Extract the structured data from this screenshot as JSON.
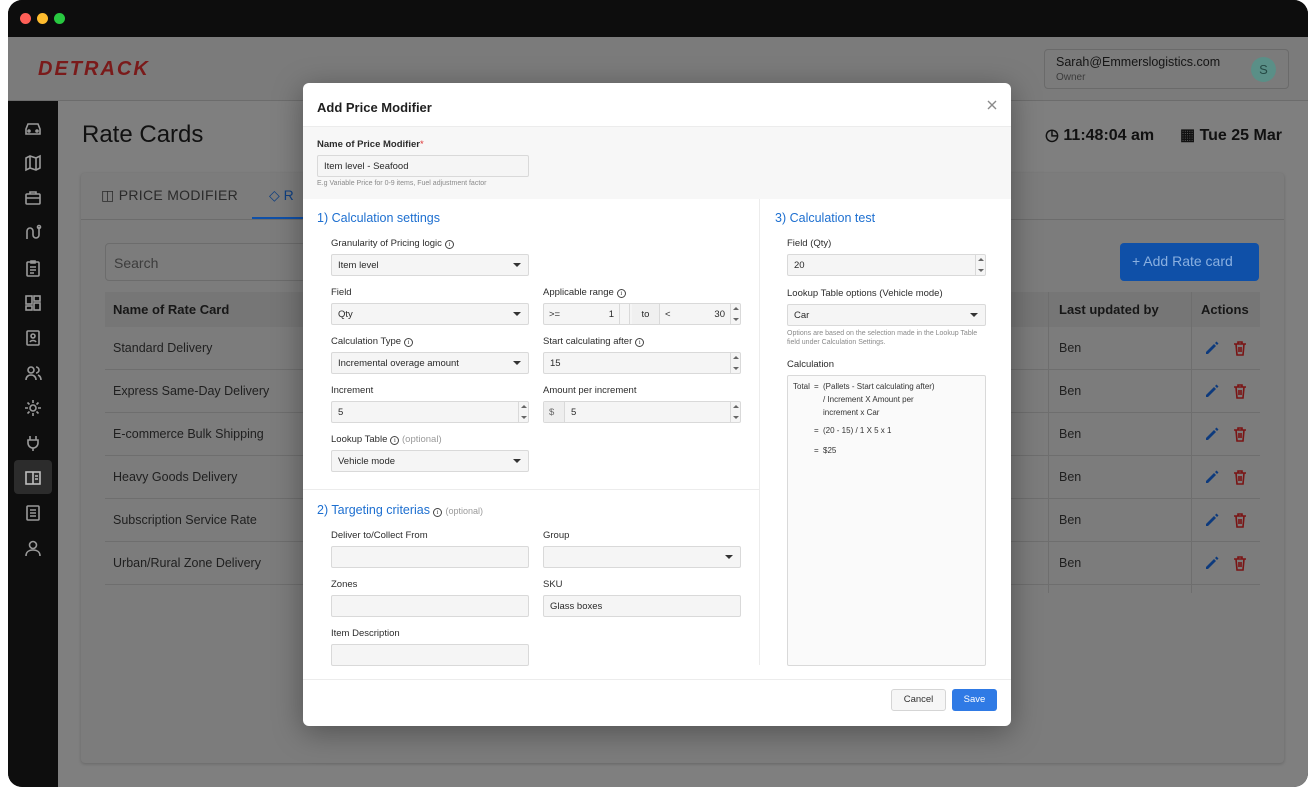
{
  "app": {
    "logo_text": "DETRACK",
    "user_email": "Sarah@Emmerslogistics.com",
    "user_role": "Owner",
    "avatar_initial": "S"
  },
  "page": {
    "title": "Rate Cards",
    "time": "11:48:04 am",
    "date": "Tue 25 Mar"
  },
  "tabs": {
    "price_modifier": "PRICE MODIFIER",
    "rate_cards_partial": "R"
  },
  "toolbar": {
    "search_placeholder": "Search",
    "add_button": "Add Rate card"
  },
  "table": {
    "headers": {
      "name": "Name of Rate Card",
      "last_updated_by": "Last updated by",
      "actions": "Actions"
    },
    "rows": [
      {
        "name": "Standard Delivery",
        "by": "Ben"
      },
      {
        "name": "Express Same-Day Delivery",
        "by": "Ben"
      },
      {
        "name": "E-commerce Bulk Shipping",
        "by": "Ben"
      },
      {
        "name": "Heavy Goods Delivery",
        "by": "Ben"
      },
      {
        "name": "Subscription Service Rate",
        "by": "Ben"
      },
      {
        "name": "Urban/Rural Zone Delivery",
        "by": "Ben"
      }
    ]
  },
  "modal": {
    "title": "Add Price Modifier",
    "name_label": "Name of Price Modifier",
    "name_value": "Item level - Seafood",
    "name_hint": "E.g Variable Price for 0-9 items, Fuel adjustment factor",
    "calc_settings": {
      "title": "1) Calculation settings",
      "granularity_label": "Granularity of Pricing logic",
      "granularity_value": "Item level",
      "field_label": "Field",
      "field_value": "Qty",
      "range_label": "Applicable range",
      "range_op1": ">=",
      "range_val1": "1",
      "range_to": "to",
      "range_op2": "<",
      "range_val2": "30",
      "calc_type_label": "Calculation Type",
      "calc_type_value": "Incremental overage amount",
      "start_after_label": "Start calculating after",
      "start_after_value": "15",
      "increment_label": "Increment",
      "increment_value": "5",
      "amount_label": "Amount per increment",
      "amount_prefix": "$",
      "amount_value": "5",
      "lookup_label": "Lookup Table",
      "lookup_optional": "(optional)",
      "lookup_value": "Vehicle mode"
    },
    "targeting": {
      "title": "2) Targeting criterias",
      "optional": "(optional)",
      "deliver_label": "Deliver to/Collect From",
      "deliver_value": "",
      "group_label": "Group",
      "group_value": "",
      "zones_label": "Zones",
      "zones_value": "",
      "sku_label": "SKU",
      "sku_value": "Glass boxes",
      "desc_label": "Item Description",
      "desc_value": ""
    },
    "calc_test": {
      "title": "3) Calculation test",
      "field_label": "Field (Qty)",
      "field_value": "20",
      "lookup_label": "Lookup Table options (Vehicle mode)",
      "lookup_value": "Car",
      "lookup_hint_1": "Options are based on the selection made in the Lookup Table",
      "lookup_hint_2": "field under Calculation Settings.",
      "calc_label": "Calculation",
      "calc_total": "Total",
      "eq": "=",
      "formula_1": "(Pallets - Start calculating after)",
      "formula_2": "/ Increment X Amount per",
      "formula_3": "increment x Car",
      "step_1": "(20 - 15) / 1 X 5 x 1",
      "result": "$25"
    },
    "cancel": "Cancel",
    "save": "Save"
  },
  "colors": {
    "accent": "#2f7ae5",
    "section_title": "#1d6fd0",
    "logo_red": "#e0222d"
  }
}
